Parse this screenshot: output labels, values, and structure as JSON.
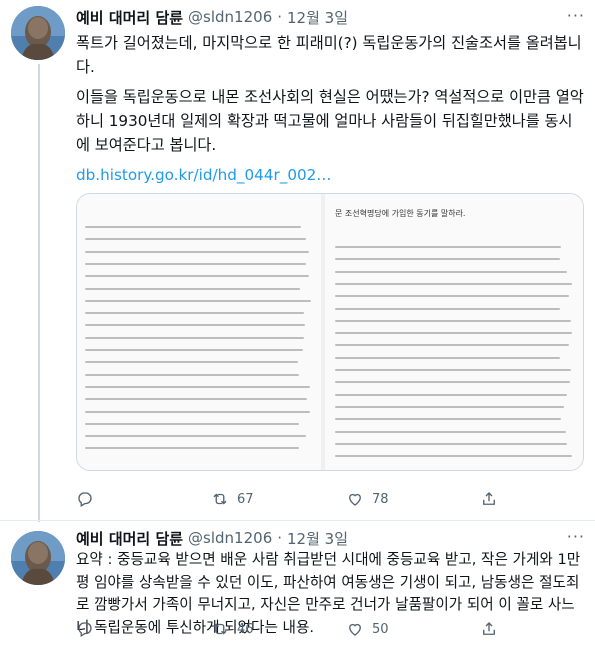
{
  "tweets": [
    {
      "author_name": "예비 대머리 담륜",
      "handle": "@sldn1206",
      "separator": "·",
      "date": "12월 3일",
      "paragraph1": "폭트가 길어졌는데, 마지막으로 한 피래미(?) 독립운동가의 진술조서를 올려봅니다.",
      "paragraph2": "이들을 독립운동으로 내몬 조선사회의 현실은 어땠는가? 역설적으로 이만큼 열악하니 1930년대 일제의 확장과 떡고물에 얼마나 사람들이 뒤집힐만했나를 동시에 보여준다고 봅니다.",
      "link": "db.history.go.kr/id/hd_044r_002…",
      "media_heading": "문 조선혁명당에 가입한 동기를 말하라.",
      "actions": {
        "reply_count": "",
        "retweet_count": "67",
        "like_count": "78"
      }
    },
    {
      "author_name": "예비 대머리 담륜",
      "handle": "@sldn1206",
      "separator": "·",
      "date": "12월 3일",
      "text": "요약 : 중등교육 받으면 배운 사람 취급받던 시대에 중등교육 받고, 작은 가게와 1만평 임야를 상속받을 수 있던 이도, 파산하여 여동생은 기생이 되고, 남동생은 절도죄로 깜빵가서 가족이 무너지고, 자신은 만주로 건너가 날품팔이가 되어 이 꼴로 사느니 독립운동에 투신하게 되었다는 내용.",
      "actions": {
        "reply_count": "",
        "retweet_count": "46",
        "like_count": "50"
      }
    }
  ],
  "more_icon": "···",
  "icons": [
    "avatar-statue",
    "reply-icon",
    "retweet-icon",
    "like-icon",
    "share-icon",
    "more-icon"
  ],
  "colors": {
    "text": "#0f1419",
    "secondary": "#536471",
    "link": "#1d9bf0",
    "border": "#cfd9de",
    "avatar_bg": "#4b84b5"
  }
}
